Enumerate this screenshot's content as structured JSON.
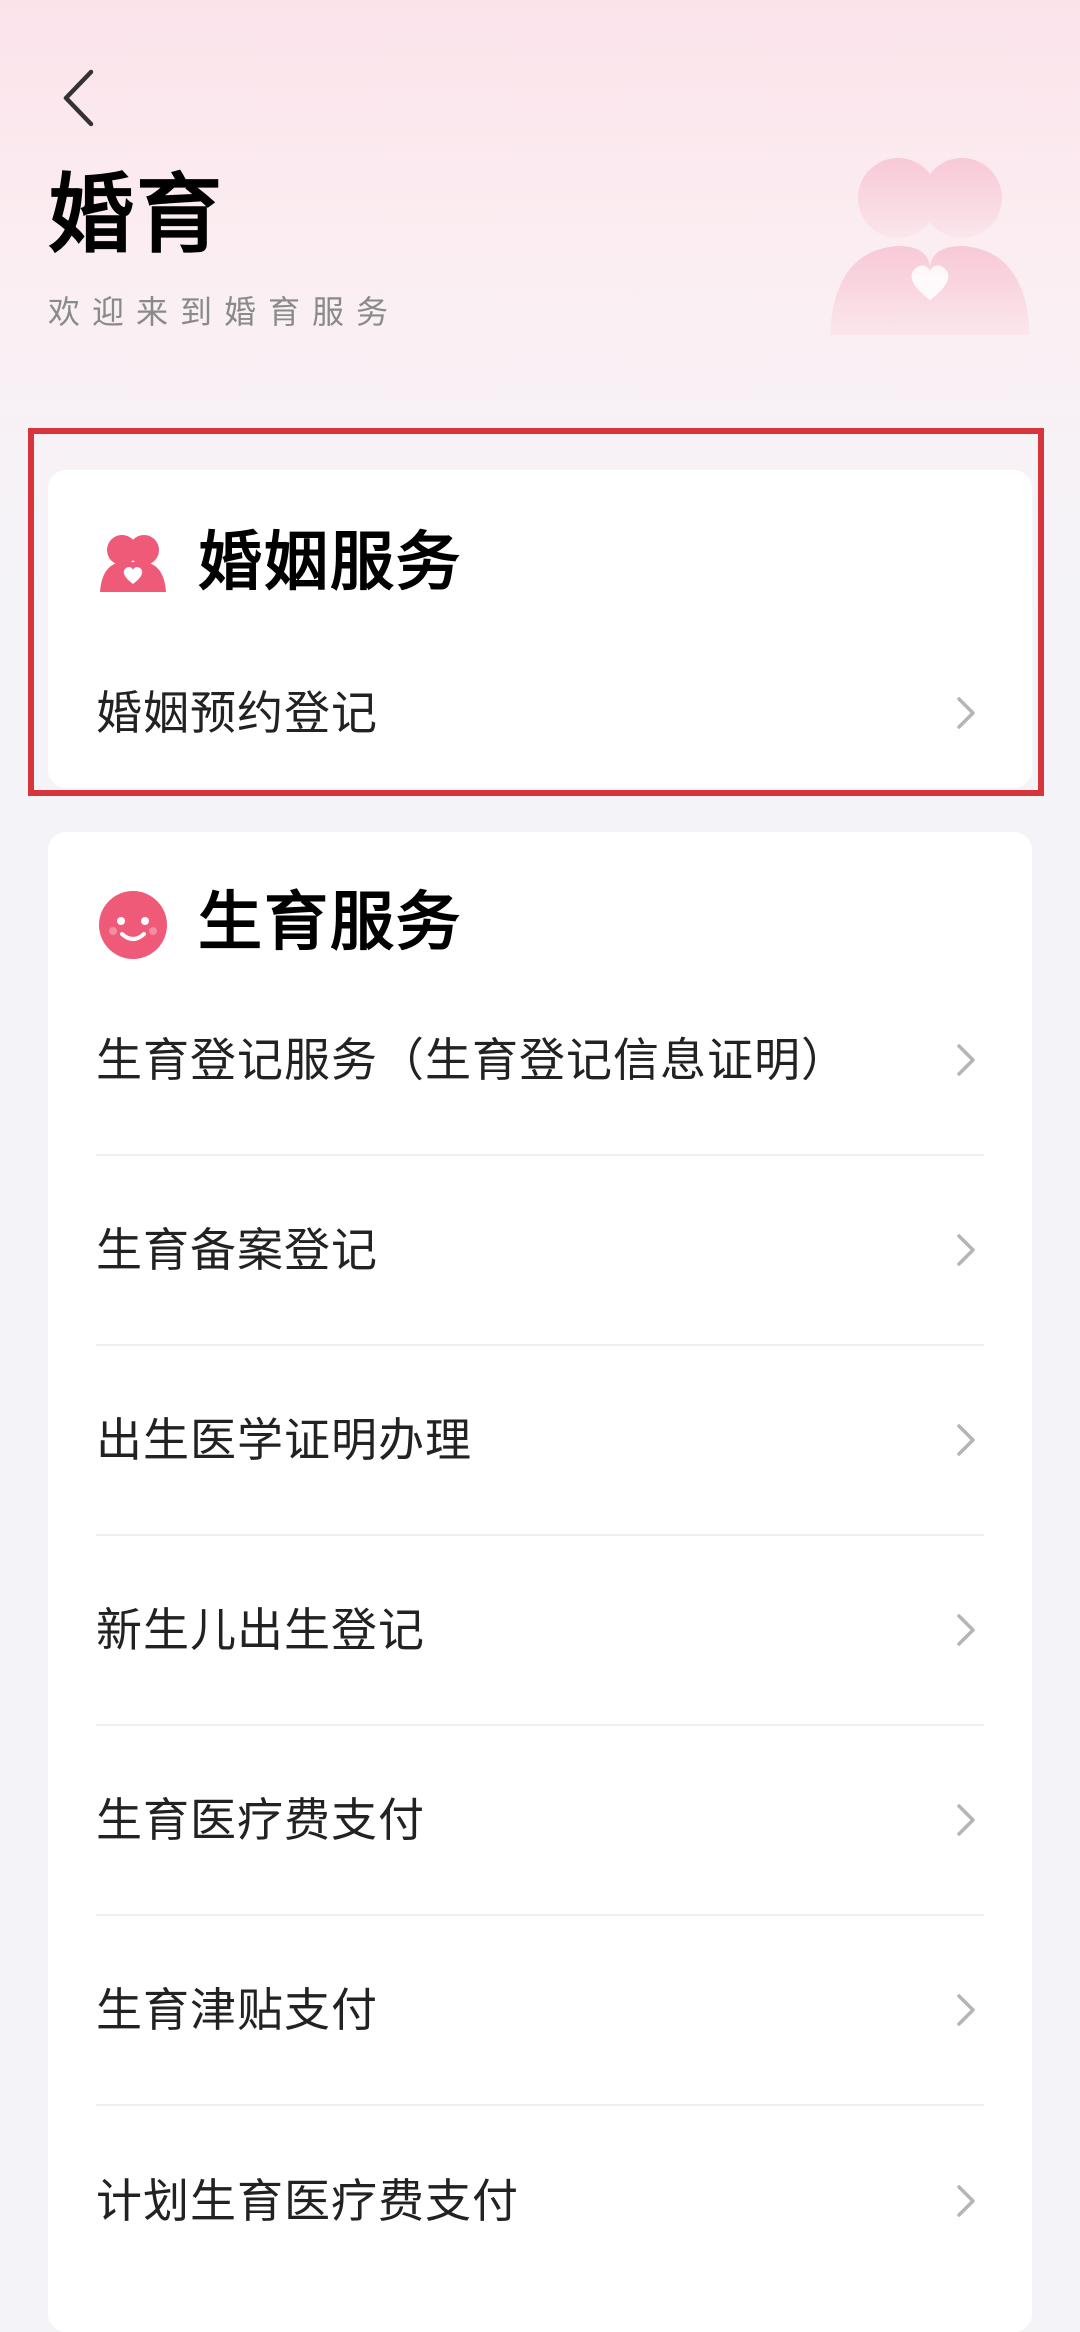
{
  "header": {
    "title": "婚育",
    "subtitle": "欢迎来到婚育服务",
    "back_icon": "chevron-left-icon"
  },
  "sections": [
    {
      "title": "婚姻服务",
      "icon": "couple-heart-icon",
      "items": [
        {
          "label": "婚姻预约登记"
        }
      ]
    },
    {
      "title": "生育服务",
      "icon": "baby-face-icon",
      "items": [
        {
          "label": "生育登记服务（生育登记信息证明）"
        },
        {
          "label": "生育备案登记"
        },
        {
          "label": "出生医学证明办理"
        },
        {
          "label": "新生儿出生登记"
        },
        {
          "label": "生育医疗费支付"
        },
        {
          "label": "生育津贴支付"
        },
        {
          "label": "计划生育医疗费支付"
        }
      ]
    }
  ],
  "colors": {
    "accent": "#ee5a78",
    "highlight_border": "#d8343c",
    "background_top": "#fbe3ea"
  }
}
